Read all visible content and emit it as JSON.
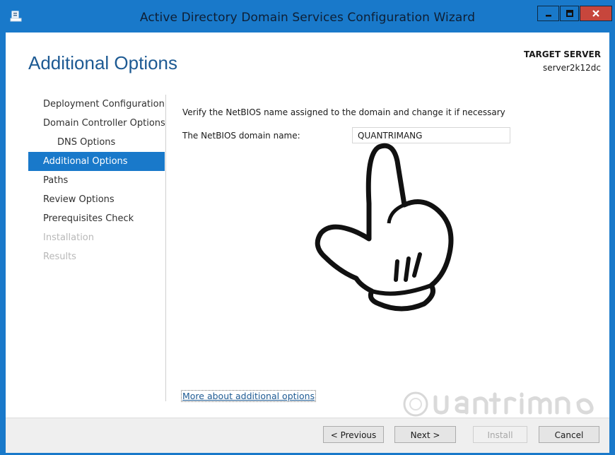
{
  "window": {
    "title": "Active Directory Domain Services Configuration Wizard",
    "icons": {
      "app": "server-manager-icon",
      "minimize": "minimize-icon",
      "maximize": "maximize-icon",
      "close": "close-icon"
    },
    "colors": {
      "titlebar": "#1979ca",
      "close": "#c7463c"
    }
  },
  "header": {
    "title": "Additional Options",
    "target_label": "TARGET SERVER",
    "target_name": "server2k12dc"
  },
  "nav": {
    "items": [
      {
        "label": "Deployment Configuration",
        "state": "normal"
      },
      {
        "label": "Domain Controller Options",
        "state": "normal"
      },
      {
        "label": "DNS Options",
        "state": "sub"
      },
      {
        "label": "Additional Options",
        "state": "active"
      },
      {
        "label": "Paths",
        "state": "normal"
      },
      {
        "label": "Review Options",
        "state": "normal"
      },
      {
        "label": "Prerequisites Check",
        "state": "normal"
      },
      {
        "label": "Installation",
        "state": "disabled"
      },
      {
        "label": "Results",
        "state": "disabled"
      }
    ]
  },
  "main": {
    "instruction": "Verify the NetBIOS name assigned to the domain and change it if necessary",
    "netbios_label": "The NetBIOS domain name:",
    "netbios_value": "QUANTRIMANG",
    "more_link": "More about additional options"
  },
  "footer": {
    "previous": "< Previous",
    "next": "Next >",
    "install": "Install",
    "cancel": "Cancel"
  },
  "overlay": {
    "pointer": "pointing-hand-icon",
    "watermark": "quantrimang-watermark"
  }
}
